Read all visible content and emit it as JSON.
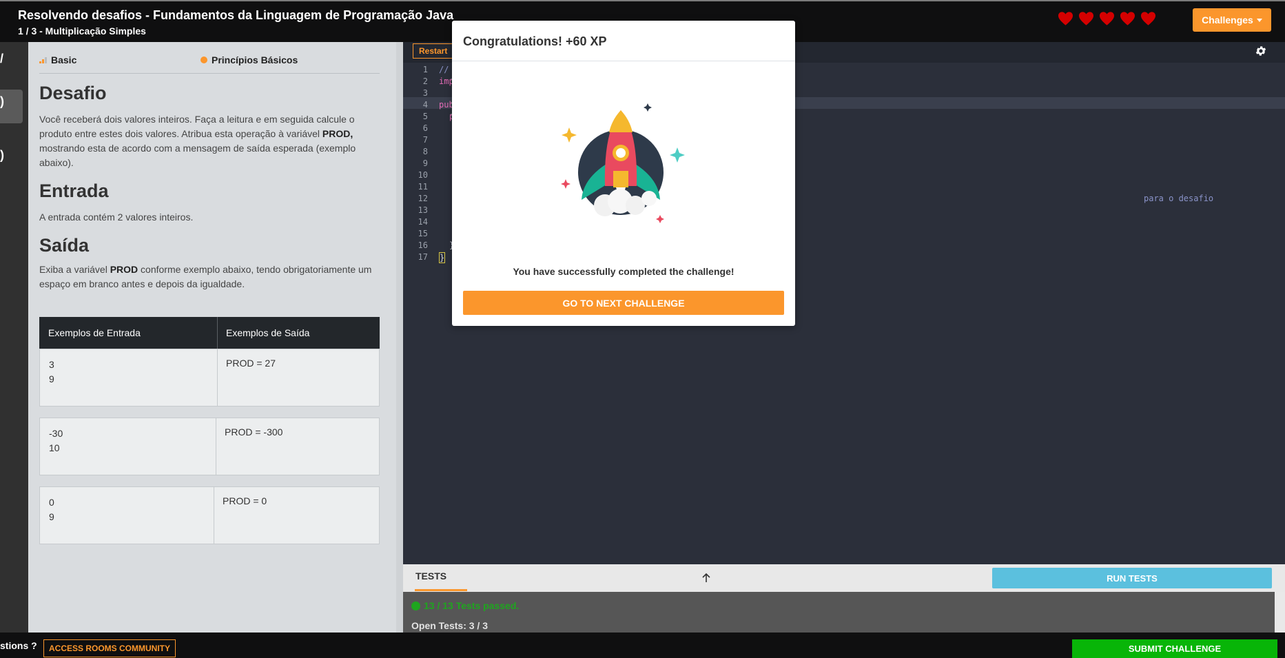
{
  "header": {
    "course_title": "Resolvendo desafios - Fundamentos da Linguagem de Programação Java",
    "challenge_subtitle": "1 / 3 - Multiplicação Simples",
    "hearts_count": 5,
    "heart_color": "#d40000",
    "challenges_label": "Challenges"
  },
  "rail": {
    "glyphs": [
      "/",
      ")",
      ")"
    ]
  },
  "description": {
    "level": "Basic",
    "topic": "Princípios Básicos",
    "desafio_heading": "Desafio",
    "desafio_text_1": "Você receberá dois valores inteiros. Faça a leitura e em seguida calcule o produto entre estes dois valores. Atribua esta operação à variável ",
    "desafio_bold": "PROD,",
    "desafio_text_2": " mostrando esta de acordo com a mensagem de saída esperada (exemplo abaixo).",
    "entrada_heading": "Entrada",
    "entrada_text": "A entrada contém 2 valores inteiros.",
    "saida_heading": "Saída",
    "saida_text_1": "Exiba a variável ",
    "saida_bold": "PROD",
    "saida_text_2": " conforme exemplo abaixo, tendo obrigatoriamente um espaço em branco antes e depois da igualdade.",
    "examples": {
      "header_input": "Exemplos de Entrada",
      "header_output": "Exemplos de Saída",
      "rows": [
        {
          "input": "3\n9",
          "output": "PROD = 27"
        },
        {
          "input": "-30\n10",
          "output": "PROD = -300"
        },
        {
          "input": "0\n9",
          "output": "PROD = 0"
        }
      ]
    }
  },
  "editor": {
    "restart_label": "Restart",
    "line_numbers": [
      "1",
      "2",
      "3",
      "4",
      "5",
      "6",
      "7",
      "8",
      "9",
      "10",
      "11",
      "12",
      "13",
      "14",
      "15",
      "16",
      "17"
    ],
    "fold_lines": [
      "2",
      "4",
      "5"
    ],
    "code_visible": {
      "line1": "//",
      "line2": "imp",
      "line4": "pub",
      "line5": "p",
      "line12_tail": "para o desafio",
      "line16": "}",
      "line17": "}"
    }
  },
  "tests": {
    "tab_label": "TESTS",
    "run_label": "RUN TESTS",
    "passed_text": "13 / 13 Tests passed.",
    "open_tests": "Open Tests: 3 / 3"
  },
  "footer": {
    "questions_text": "stions ?",
    "community_label": "ACCESS ROOMS COMMUNITY",
    "submit_label": "SUBMIT CHALLENGE"
  },
  "modal": {
    "title": "Congratulations! +60 XP",
    "message": "You have successfully completed the challenge!",
    "next_label": "GO TO NEXT CHALLENGE"
  },
  "colors": {
    "accent": "#fb962c",
    "success": "#08b508",
    "info": "#5bc0de"
  }
}
